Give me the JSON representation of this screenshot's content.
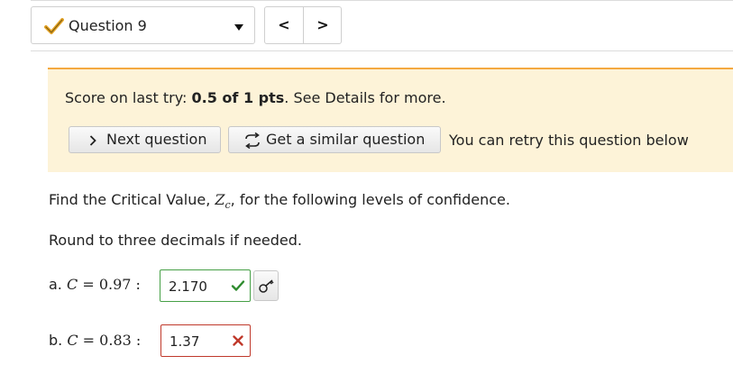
{
  "nav": {
    "question_label": "Question 9",
    "prev_symbol": "<",
    "next_symbol": ">"
  },
  "banner": {
    "score_prefix": "Score on last try: ",
    "score_value": "0.5 of 1 pts",
    "score_suffix": ". See Details for more.",
    "next_question_label": "Next question",
    "similar_question_label": "Get a similar question",
    "retry_text": "You can retry this question below"
  },
  "question": {
    "prompt_prefix": "Find the Critical Value, ",
    "prompt_var": "Z",
    "prompt_sub": "c",
    "prompt_suffix": ", for the following levels of confidence.",
    "round_text": "Round to three decimals if needed.",
    "parts": [
      {
        "letter": "a.",
        "var": "C",
        "eq": " = 0.97 :",
        "answer": "2.170",
        "status": "correct"
      },
      {
        "letter": "b.",
        "var": "C",
        "eq": " = 0.83 :",
        "answer": "1.37",
        "status": "incorrect"
      }
    ]
  },
  "colors": {
    "banner_bg": "#fdf3d8",
    "banner_accent": "#f4a940",
    "correct": "#2e8b2e",
    "incorrect": "#c0392b"
  },
  "icons": {
    "question_status": "check-mark-icon",
    "similar": "refresh-icon",
    "next": "chevron-right-icon",
    "key": "key-icon"
  }
}
